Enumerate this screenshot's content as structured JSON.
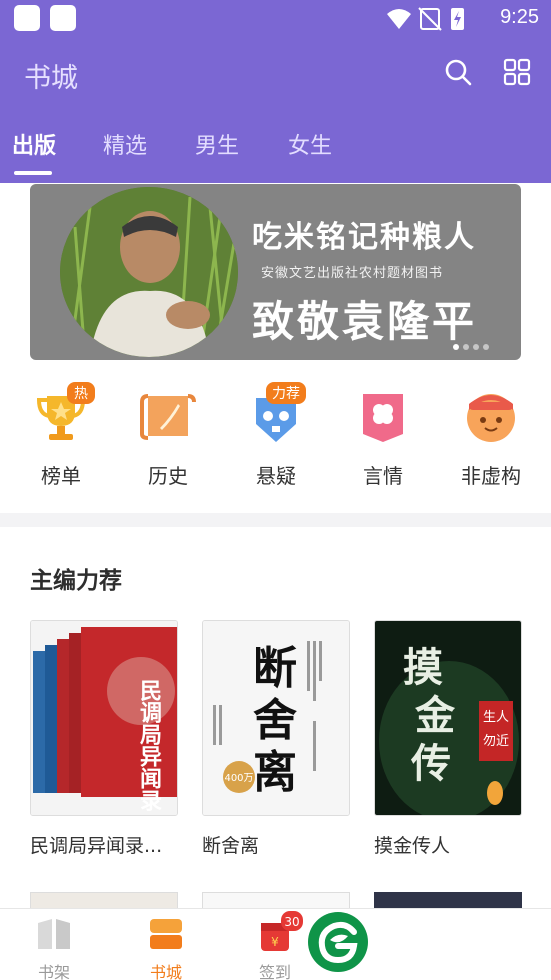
{
  "status_bar": {
    "time": "9:25"
  },
  "header": {
    "title": "书城",
    "tabs": [
      {
        "label": "出版",
        "active": true
      },
      {
        "label": "精选",
        "active": false
      },
      {
        "label": "男生",
        "active": false
      },
      {
        "label": "女生",
        "active": false
      }
    ]
  },
  "banner": {
    "headline": "吃米铭记种粮人",
    "subline": "安徽文艺出版社农村题材图书",
    "title": "致敬袁隆平",
    "slide_count": 4,
    "active_slide": 1
  },
  "categories": [
    {
      "label": "榜单",
      "icon": "trophy-icon",
      "badge": "热"
    },
    {
      "label": "历史",
      "icon": "scroll-icon",
      "badge": ""
    },
    {
      "label": "悬疑",
      "icon": "skull-icon",
      "badge": "力荐"
    },
    {
      "label": "言情",
      "icon": "clover-card-icon",
      "badge": ""
    },
    {
      "label": "非虚构",
      "icon": "face-icon",
      "badge": ""
    }
  ],
  "section": {
    "title": "主编力荐",
    "books": [
      {
        "title": "民调局异闻录...",
        "cover_text": "民调局异闻录",
        "cover_color": "#c4282b"
      },
      {
        "title": "断舍离",
        "cover_text": "断舍离",
        "cover_badge": "400万",
        "cover_color": "#f6f6f6"
      },
      {
        "title": "摸金传人",
        "cover_text": "摸金传人",
        "cover_tag": "生人勿近",
        "cover_color": "#0e1c12"
      }
    ]
  },
  "bottom_nav": {
    "items": [
      {
        "label": "书架",
        "icon": "bookshelf-icon",
        "active": false
      },
      {
        "label": "书城",
        "icon": "store-icon",
        "active": true
      },
      {
        "label": "签到",
        "icon": "redpacket-icon",
        "active": false,
        "badge": "30"
      }
    ]
  },
  "colors": {
    "brand": "#7b67d3",
    "accent": "#f27d1c",
    "fab": "#0f9448"
  }
}
